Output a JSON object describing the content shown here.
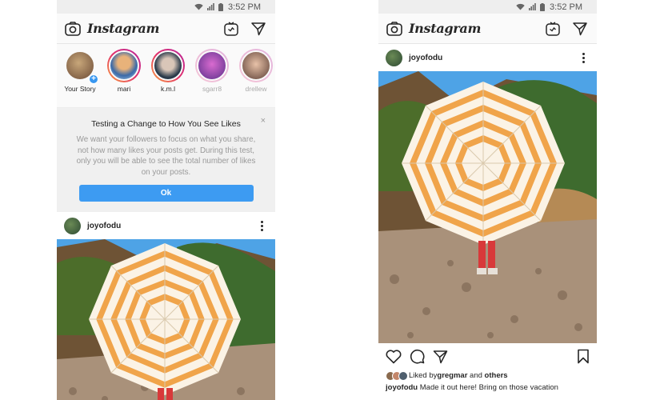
{
  "status_bar": {
    "time": "3:52 PM"
  },
  "app": {
    "title": "Instagram"
  },
  "stories": [
    {
      "name": "Your Story",
      "own": true,
      "faded": false,
      "colors": [
        "#c8a77a",
        "#6b4a35"
      ]
    },
    {
      "name": "mari",
      "own": false,
      "faded": false,
      "colors": [
        "#b3d6f2",
        "#3b6aa8"
      ]
    },
    {
      "name": "k.m.l",
      "own": false,
      "faded": false,
      "colors": [
        "#2a3a4a",
        "#d9c6b8"
      ]
    },
    {
      "name": "sgarr8",
      "own": false,
      "faded": true,
      "colors": [
        "#d96bd0",
        "#5a2f8a"
      ]
    },
    {
      "name": "drellew",
      "own": false,
      "faded": true,
      "colors": [
        "#e8c2a8",
        "#5a3d34"
      ]
    }
  ],
  "notice": {
    "title": "Testing a Change to How You See Likes",
    "body": "We want your followers to focus on what you share, not how many likes your posts get. During this test, only you will be able to see the total number of likes on your posts.",
    "button": "Ok",
    "close": "×"
  },
  "post": {
    "username": "joyofodu",
    "liked_by_prefix": "Liked by ",
    "liked_by_user": "gregmar",
    "liked_by_and": " and ",
    "liked_by_others": "others",
    "caption_user": "joyofodu",
    "caption_text": " Made it out here! Bring on those vacation"
  },
  "colors": {
    "accent": "#3d9bf2",
    "umbrella_stripe": "#f0a44a",
    "umbrella_white": "#fbf3e6",
    "sky": "#4ea3e6"
  }
}
